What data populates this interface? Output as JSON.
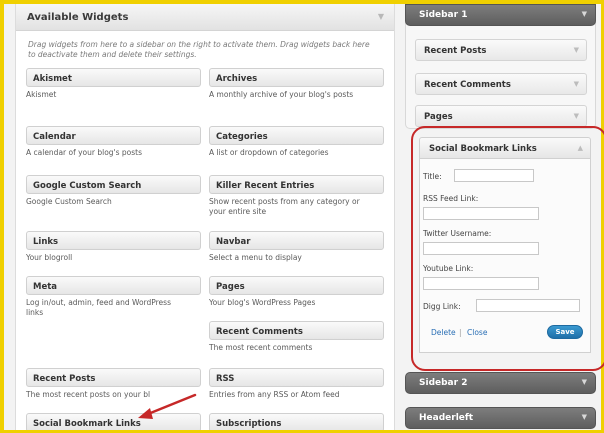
{
  "available": {
    "title": "Available Widgets",
    "description": "Drag widgets from here to a sidebar on the right to activate them. Drag widgets back here to deactivate them and delete their settings.",
    "widgets": [
      {
        "name": "Akismet",
        "desc": "Akismet"
      },
      {
        "name": "Archives",
        "desc": "A monthly archive of your blog's posts"
      },
      {
        "name": "Calendar",
        "desc": "A calendar of your blog's posts"
      },
      {
        "name": "Categories",
        "desc": "A list or dropdown of categories"
      },
      {
        "name": "Google Custom Search",
        "desc": "Google Custom Search"
      },
      {
        "name": "Killer Recent Entries",
        "desc": "Show recent posts from any category or your entire site"
      },
      {
        "name": "Links",
        "desc": "Your blogroll"
      },
      {
        "name": "Navbar",
        "desc": "Select a menu to display"
      },
      {
        "name": "Meta",
        "desc": "Log in/out, admin, feed and WordPress links"
      },
      {
        "name": "Pages",
        "desc": "Your blog's WordPress Pages"
      },
      {
        "name": "Recent Comments",
        "desc": "The most recent comments"
      },
      {
        "name": "Recent Posts",
        "desc": "The most recent posts on your bl"
      },
      {
        "name": "RSS",
        "desc": "Entries from any RSS or Atom feed"
      },
      {
        "name": "Social Bookmark Links",
        "desc": ""
      },
      {
        "name": "Subscriptions",
        "desc": ""
      }
    ]
  },
  "sidebar1": {
    "title": "Sidebar 1",
    "items": [
      "Recent Posts",
      "Recent Comments",
      "Pages"
    ]
  },
  "social_widget": {
    "title": "Social Bookmark Links",
    "fields": [
      {
        "label": "Title:",
        "value": ""
      },
      {
        "label": "RSS Feed Link:",
        "value": ""
      },
      {
        "label": "Twitter Username:",
        "value": ""
      },
      {
        "label": "Youtube Link:",
        "value": ""
      },
      {
        "label": "Digg Link:",
        "value": ""
      }
    ],
    "delete_label": "Delete",
    "separator": "|",
    "close_label": "Close",
    "save_label": "Save"
  },
  "sidebar2": {
    "title": "Sidebar 2"
  },
  "header_left": {
    "title": "Headerleft"
  },
  "colors": {
    "accent": "#c62828",
    "save_button": "#2a85c0",
    "link": "#2a6fb5"
  }
}
